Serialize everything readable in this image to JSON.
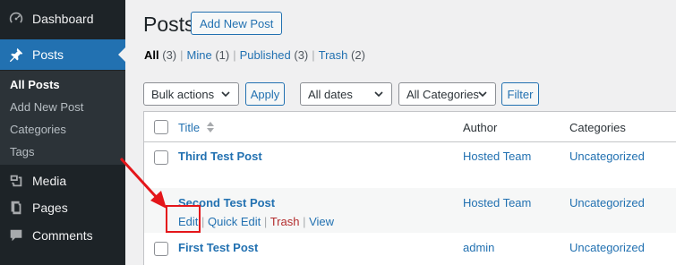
{
  "sidebar": {
    "dashboard": "Dashboard",
    "posts": "Posts",
    "submenu": [
      "All Posts",
      "Add New Post",
      "Categories",
      "Tags"
    ],
    "media": "Media",
    "pages": "Pages",
    "comments": "Comments"
  },
  "header": {
    "title": "Posts",
    "add_new": "Add New Post"
  },
  "filters": {
    "all": "All",
    "all_count": "(3)",
    "mine": "Mine",
    "mine_count": "(1)",
    "published": "Published",
    "published_count": "(3)",
    "trash": "Trash",
    "trash_count": "(2)",
    "separator": "|"
  },
  "toolbar": {
    "bulk_actions": "Bulk actions",
    "apply": "Apply",
    "all_dates": "All dates",
    "all_categories": "All Categories",
    "filter": "Filter"
  },
  "table": {
    "columns": {
      "title": "Title",
      "author": "Author",
      "categories": "Categories"
    },
    "rows": [
      {
        "title": "Third Test Post",
        "author": "Hosted Team",
        "category": "Uncategorized"
      },
      {
        "title": "Second Test Post",
        "author": "Hosted Team",
        "category": "Uncategorized"
      },
      {
        "title": "First Test Post",
        "author": "admin",
        "category": "Uncategorized"
      }
    ],
    "row_actions": {
      "edit": "Edit",
      "quick_edit": "Quick Edit",
      "trash": "Trash",
      "view": "View",
      "separator": "|"
    }
  },
  "colors": {
    "sidebar_bg": "#1d2327",
    "accent": "#2271b1",
    "trash": "#b32d2e",
    "highlight": "#e4161a"
  },
  "icons": [
    "dashboard-icon",
    "pushpin-icon",
    "media-icon",
    "pages-icon",
    "comments-icon",
    "sort-icon",
    "chevron-down-icon",
    "red-arrow"
  ]
}
